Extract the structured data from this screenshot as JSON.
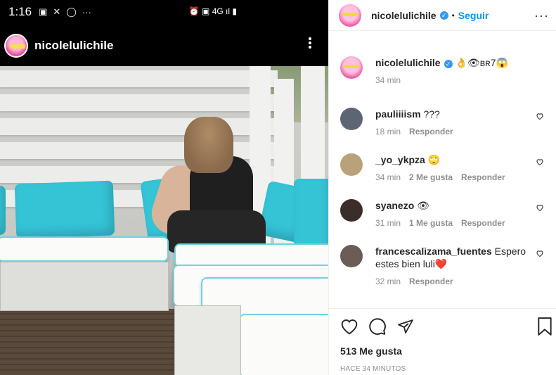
{
  "phone": {
    "status": {
      "time": "1:16",
      "icons": [
        "image-icon",
        "missed-call-icon",
        "whatsapp-icon",
        "more-dots-icon"
      ],
      "right_icons": [
        "alarm-icon",
        "volte-icon",
        "4g-icon",
        "signal-icon",
        "battery-icon"
      ],
      "more": "···",
      "right_text": "⏰ ▣ 4G ıl ▮"
    },
    "header": {
      "username": "nicolelulichile"
    }
  },
  "post": {
    "header": {
      "username": "nicolelulichile",
      "separator": "•",
      "follow_label": "Seguir",
      "more": "···"
    },
    "caption": {
      "username": "nicolelulichile",
      "text": "👌👁ʙʀ7😱",
      "time": "34 min"
    },
    "comments": [
      {
        "username": "pauliiiism",
        "text": "???",
        "time": "18 min",
        "likes": "",
        "reply": "Responder",
        "avatar_color": "#5c6672"
      },
      {
        "username": "_yo_ykpza",
        "text": "🙄",
        "time": "34 min",
        "likes": "2 Me gusta",
        "reply": "Responder",
        "avatar_color": "#b9a27a"
      },
      {
        "username": "syanezo",
        "text": "👁",
        "time": "31 min",
        "likes": "1 Me gusta",
        "reply": "Responder",
        "avatar_color": "#3b2e2a"
      },
      {
        "username": "francescalizama_fuentes",
        "text": "Espero estes bien luli❤️",
        "time": "32 min",
        "likes": "",
        "reply": "Responder",
        "avatar_color": "#6d5b58"
      }
    ],
    "likes": "513 Me gusta",
    "ago": "HACE 34 MINUTOS"
  },
  "colors": {
    "accent": "#0095f6",
    "verified": "#3897f0",
    "muted": "#8e8e8e",
    "cushion": "#35c3d6"
  }
}
